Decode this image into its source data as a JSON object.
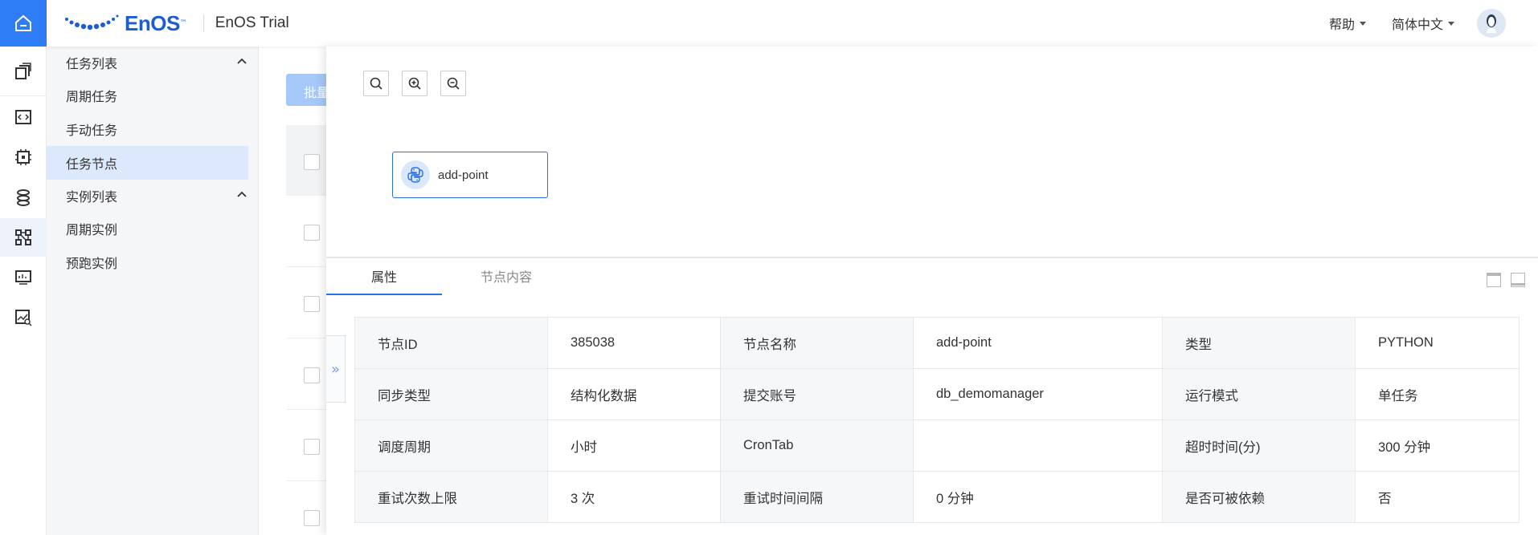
{
  "header": {
    "logo_text": "EnOS",
    "logo_tm": "™",
    "app_name": "EnOS Trial",
    "help_label": "帮助",
    "language_label": "简体中文"
  },
  "sidebar": {
    "groups": [
      {
        "label": "任务列表",
        "items": [
          "周期任务",
          "手动任务",
          "任务节点"
        ]
      },
      {
        "label": "实例列表",
        "items": [
          "周期实例",
          "预跑实例"
        ]
      }
    ],
    "active_item": "任务节点"
  },
  "background_page": {
    "batch_button_label": "批量"
  },
  "dag": {
    "node_label": "add-point"
  },
  "tabs": [
    {
      "label": "属性",
      "active": true
    },
    {
      "label": "节点内容",
      "active": false
    }
  ],
  "properties": [
    [
      {
        "label": "节点ID",
        "value": "385038"
      },
      {
        "label": "节点名称",
        "value": "add-point"
      },
      {
        "label": "类型",
        "value": "PYTHON"
      }
    ],
    [
      {
        "label": "同步类型",
        "value": "结构化数据"
      },
      {
        "label": "提交账号",
        "value": "db_demomanager"
      },
      {
        "label": "运行模式",
        "value": "单任务"
      }
    ],
    [
      {
        "label": "调度周期",
        "value": "小时"
      },
      {
        "label": "CronTab",
        "value": ""
      },
      {
        "label": "超时时间(分)",
        "value": "300 分钟"
      }
    ],
    [
      {
        "label": "重试次数上限",
        "value": "3 次"
      },
      {
        "label": "重试时间间隔",
        "value": "0 分钟"
      },
      {
        "label": "是否可被依赖",
        "value": "否"
      }
    ]
  ],
  "colors": {
    "accent": "#2b72e8",
    "rail_home": "#2e7cf6",
    "sidebar_active": "#dce8fb"
  }
}
